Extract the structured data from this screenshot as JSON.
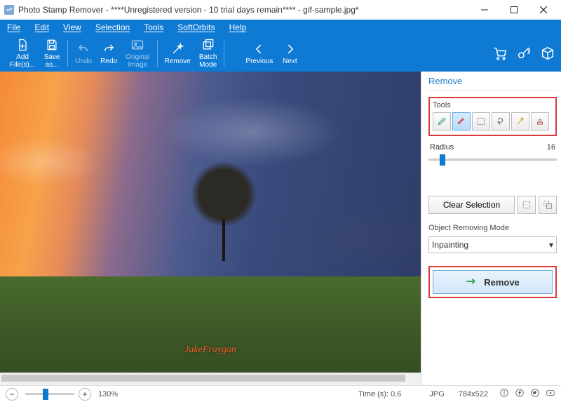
{
  "window": {
    "title": "Photo Stamp Remover - ****Unregistered version - 10 trial days remain**** - gif-sample.jpg*"
  },
  "menu": {
    "items": [
      "File",
      "Edit",
      "View",
      "Selection",
      "Tools",
      "SoftOrbits",
      "Help"
    ]
  },
  "toolbar": {
    "add_files": "Add\nFile(s)...",
    "save_as": "Save\nas...",
    "undo": "Undo",
    "redo": "Redo",
    "original_image": "Original\nImage",
    "remove": "Remove",
    "batch_mode": "Batch\nMode",
    "previous": "Previous",
    "next": "Next"
  },
  "side": {
    "panel_title": "Remove",
    "tools_label": "Tools",
    "tool_icons": [
      "pencil",
      "brush",
      "rect",
      "lasso",
      "magic-wand",
      "stamp"
    ],
    "selected_tool_index": 1,
    "radius_label": "Radius",
    "radius_value": "16",
    "clear_selection": "Clear Selection",
    "mode_label": "Object Removing Mode",
    "mode_value": "Inpainting",
    "remove_label": "Remove"
  },
  "image": {
    "watermark_text": "JakeFraygan"
  },
  "status": {
    "zoom": "130%",
    "time": "Time (s): 0.6",
    "format": "JPG",
    "size": "784x522"
  }
}
